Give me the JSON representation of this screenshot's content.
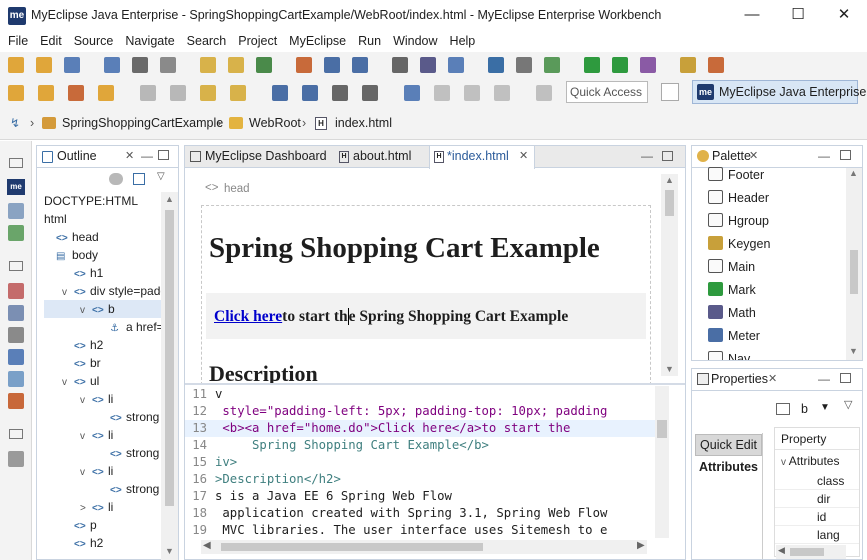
{
  "window": {
    "title": "MyEclipse Java Enterprise - SpringShoppingCartExample/WebRoot/index.html - MyEclipse Enterprise Workbench",
    "logo": "me"
  },
  "menu": [
    "File",
    "Edit",
    "Source",
    "Navigate",
    "Search",
    "Project",
    "MyEclipse",
    "Run",
    "Window",
    "Help"
  ],
  "toolbar": {
    "quick_access": "Quick Access",
    "perspective": "MyEclipse Java Enterprise",
    "perspective_logo": "me"
  },
  "breadcrumb": [
    "SpringShoppingCartExample",
    "WebRoot",
    "index.html"
  ],
  "outline": {
    "tab": "Outline",
    "items": [
      {
        "label": "DOCTYPE:HTML",
        "indent": 0,
        "chev": "",
        "tag": ""
      },
      {
        "label": "html",
        "indent": 0,
        "chev": "",
        "tag": ""
      },
      {
        "label": "head",
        "indent": 0,
        "chev": "",
        "tag": "<>"
      },
      {
        "label": "body",
        "indent": 0,
        "chev": "",
        "tag": "▤"
      },
      {
        "label": "h1",
        "indent": 1,
        "chev": "",
        "tag": "<>"
      },
      {
        "label": "div style=padd",
        "indent": 1,
        "chev": "v",
        "tag": "<>"
      },
      {
        "label": "b",
        "indent": 2,
        "chev": "v",
        "tag": "<>"
      },
      {
        "label": "a href=",
        "indent": 3,
        "chev": "",
        "tag": "⚓"
      },
      {
        "label": "h2",
        "indent": 1,
        "chev": "",
        "tag": "<>"
      },
      {
        "label": "br",
        "indent": 1,
        "chev": "",
        "tag": "<>"
      },
      {
        "label": "ul",
        "indent": 1,
        "chev": "v",
        "tag": "<>"
      },
      {
        "label": "li",
        "indent": 2,
        "chev": "v",
        "tag": "<>"
      },
      {
        "label": "strong",
        "indent": 3,
        "chev": "",
        "tag": "<>"
      },
      {
        "label": "li",
        "indent": 2,
        "chev": "v",
        "tag": "<>"
      },
      {
        "label": "strong",
        "indent": 3,
        "chev": "",
        "tag": "<>"
      },
      {
        "label": "li",
        "indent": 2,
        "chev": "v",
        "tag": "<>"
      },
      {
        "label": "strong",
        "indent": 3,
        "chev": "",
        "tag": "<>"
      },
      {
        "label": "li",
        "indent": 2,
        "chev": ">",
        "tag": "<>"
      },
      {
        "label": "p",
        "indent": 1,
        "chev": "",
        "tag": "<>"
      },
      {
        "label": "h2",
        "indent": 1,
        "chev": "",
        "tag": "<>"
      }
    ]
  },
  "editor": {
    "tabs": [
      "MyEclipse Dashboard",
      "about.html",
      "*index.html"
    ],
    "preview": {
      "head_label": "head",
      "h1": "Spring Shopping Cart Example",
      "link": "Click here",
      "rest_before": "to start th",
      "rest_after": "e Spring Shopping Cart Example",
      "h2": "Description"
    },
    "code": [
      {
        "n": "11",
        "t": "v"
      },
      {
        "n": "12",
        "t": " style=\"padding-left: 5px; padding-top: 10px; padding"
      },
      {
        "n": "13",
        "t": " <b><a href=\"home.do\">Click here</a>to start the"
      },
      {
        "n": "14",
        "t": "     Spring Shopping Cart Example</b>"
      },
      {
        "n": "15",
        "t": "iv>"
      },
      {
        "n": "16",
        "t": ">Description</h2>"
      },
      {
        "n": "17",
        "t": "s is a Java EE 6 Spring Web Flow"
      },
      {
        "n": "18",
        "t": " application created with Spring 3.1, Spring Web Flow"
      },
      {
        "n": "19",
        "t": " MVC libraries. The user interface uses Sitemesh to e"
      }
    ]
  },
  "palette": {
    "tab": "Palette",
    "items": [
      "Footer",
      "Header",
      "Hgroup",
      "Keygen",
      "Main",
      "Mark",
      "Math",
      "Meter",
      "Nav"
    ]
  },
  "properties": {
    "tab": "Properties",
    "selected": "b",
    "quick_edit": "Quick Edit",
    "attributes_tab": "Attributes",
    "col_header": "Property",
    "group": "Attributes",
    "attrs": [
      "class",
      "dir",
      "id",
      "lang"
    ]
  }
}
